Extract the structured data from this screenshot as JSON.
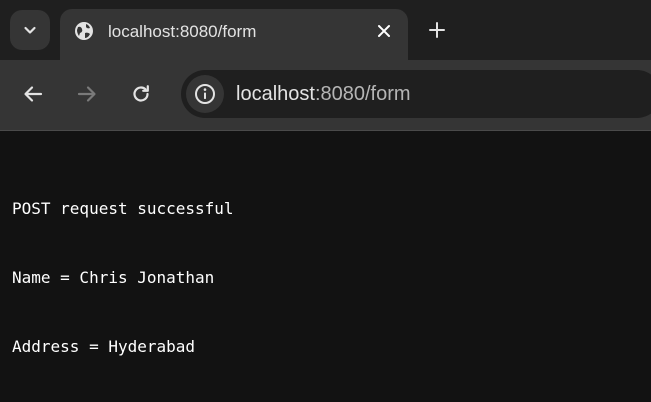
{
  "browser": {
    "tab": {
      "title": "localhost:8080/form",
      "favicon": "globe-icon"
    },
    "omnibox": {
      "host": "localhost",
      "path": ":8080/form"
    },
    "icons": {
      "tab_search": "chevron-down-icon",
      "close": "close-icon",
      "new_tab": "plus-icon",
      "back": "arrow-left-icon",
      "forward": "arrow-right-icon",
      "reload": "reload-icon",
      "site_info": "info-icon"
    },
    "colors": {
      "tabstrip": "#1f1f1f",
      "toolbar": "#353535",
      "page_background": "#121212",
      "text": "#ffffff"
    }
  },
  "page": {
    "lines": [
      "POST request successful",
      "Name = Chris Jonathan",
      "Address = Hyderabad"
    ]
  }
}
